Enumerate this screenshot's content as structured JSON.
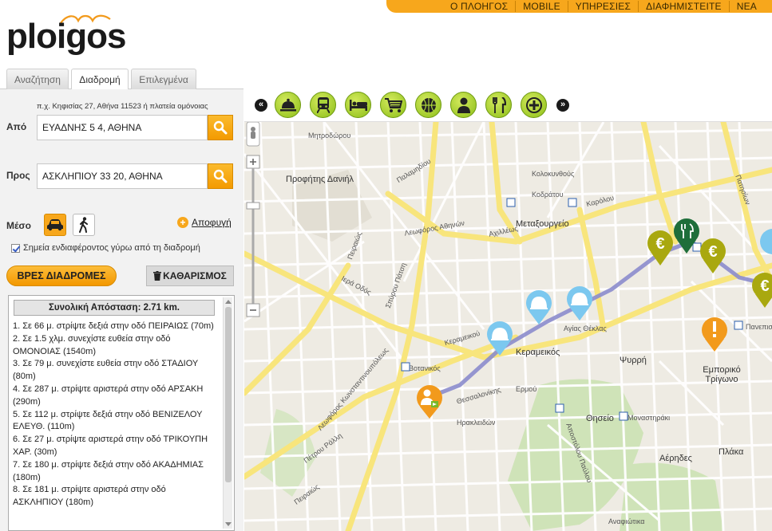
{
  "nav": {
    "items": [
      "Ο ΠΛΟΗΓΟΣ",
      "MOBILE",
      "ΥΠΗΡΕΣΙΕΣ",
      "ΔΙΑΦΗΜΙΣΤΕΙΤΕ",
      "ΝΕΑ"
    ]
  },
  "logo": {
    "text": "ploigos"
  },
  "tabs": [
    "Αναζήτηση",
    "Διαδρομή",
    "Επιλεγμένα"
  ],
  "form": {
    "hint": "π.χ. Κηφισίας 27, Αθήνα 11523 ή πλατεία ομόνοιας",
    "from_label": "Από",
    "from_value": "ΕΥΑΔΝΗΣ 5 4, ΑΘΗΝΑ",
    "to_label": "Προς",
    "to_value": "ΑΣΚΛΗΠΙΟΥ 33 20, ΑΘΗΝΑ",
    "mode_label": "Μέσο",
    "avoid_label": "Αποφυγή",
    "poi_label": "Σημεία ενδιαφέροντος γύρω από τη διαδρομή",
    "find_button": "ΒΡΕΣ ΔΙΑΔΡΟΜΕΣ",
    "clear_button": "ΚΑΘΑΡΙΣΜΟΣ"
  },
  "directions": {
    "total": "Συνολική Απόσταση: 2.71 km.",
    "steps": [
      "1. Σε 66 μ. στρίψτε δεξιά στην οδό ΠΕΙΡΑΙΩΣ (70m)",
      "2. Σε 1.5 χλμ. συνεχίστε ευθεία στην οδό ΟΜΟΝΟΙΑΣ (1540m)",
      "3. Σε 79 μ. συνεχίστε ευθεία στην οδό ΣΤΑΔΙΟΥ (80m)",
      "4. Σε 287 μ. στρίψτε αριστερά στην οδό ΑΡΣΑΚΗ (290m)",
      "5. Σε 112 μ. στρίψτε δεξιά στην οδό ΒΕΝΙΖΕΛΟΥ ΕΛΕΥΘ. (110m)",
      "6. Σε 27 μ. στρίψτε αριστερά στην οδό ΤΡΙΚΟΥΠΗ ΧΑΡ. (30m)",
      "7. Σε 180 μ. στρίψτε δεξιά στην οδό ΑΚΑΔΗΜΙΑΣ (180m)",
      "8. Σε 181 μ. στρίψτε αριστερά στην οδό ΑΣΚΛΗΠΙΟΥ (180m)"
    ]
  },
  "categories": [
    "hotel-service-icon",
    "train-icon",
    "bed-icon",
    "cart-icon",
    "basketball-icon",
    "person-icon",
    "restaurant-icon",
    "add-icon"
  ],
  "map": {
    "labels": [
      "Μητροδώρου",
      "Προφήτης Δανιήλ",
      "Ιερά Οδός",
      "Λεωφόρος Αθηνών",
      "Αχιλλέως",
      "Καρόλου",
      "Μεταξουργείο",
      "Κεραμεικός",
      "Βοτανικός",
      "Ψυρρή",
      "Θησείο",
      "Μοναστηράκι",
      "Εμπορικό Τρίγωνο",
      "Πανεπιστήμιο",
      "Αέρηδες",
      "Πλάκα",
      "Αναφιώτικα",
      "Πέτρου Ράλλη",
      "Πειραιώς",
      "Ερμού",
      "Θεσσαλονίκης",
      "Ηρακλειδών",
      "Αποστόλου Παύλου",
      "Παλαμηδίου",
      "Λεωφόρος Κωνσταντινουπόλεως",
      "Πειραιώς",
      "Κολοκυνθούς",
      "Σπύρου Πάτση",
      "Κοδράτου",
      "Πατησίων",
      "Κεραμεικού",
      "Αγίας Θέκλας"
    ]
  }
}
